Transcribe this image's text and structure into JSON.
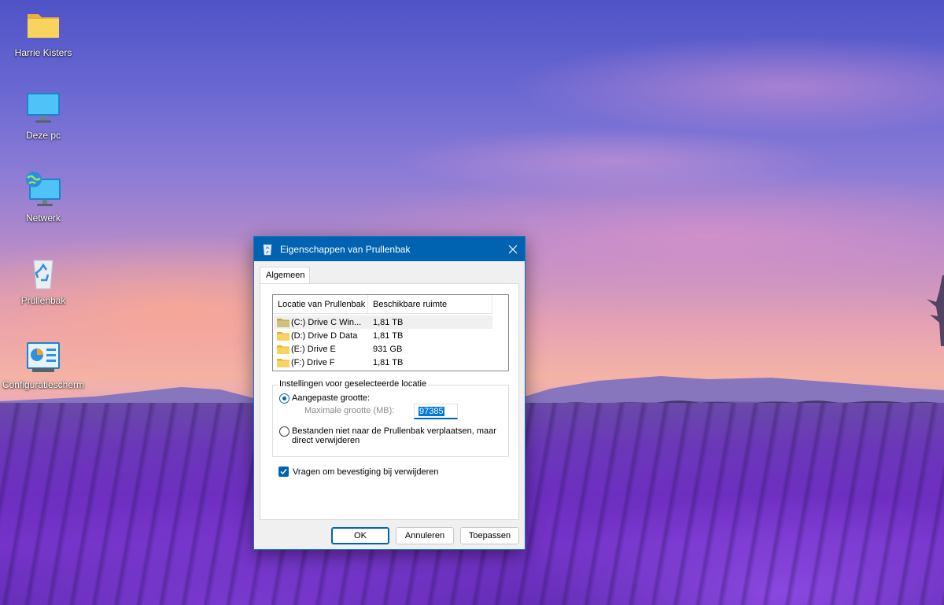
{
  "desktop": {
    "icons": [
      {
        "label": "Harrie Kisters",
        "icon": "folder-icon"
      },
      {
        "label": "Deze pc",
        "icon": "computer-icon"
      },
      {
        "label": "Netwerk",
        "icon": "network-icon"
      },
      {
        "label": "Prullenbak",
        "icon": "recycle-bin-icon"
      },
      {
        "label": "Configuratiescherm",
        "icon": "control-panel-icon"
      }
    ]
  },
  "dialog": {
    "title": "Eigenschappen van Prullenbak",
    "accent": "#0063b1",
    "tabs": [
      "Algemeen"
    ],
    "list": {
      "headers": [
        "Locatie van Prullenbak",
        "Beschikbare ruimte"
      ],
      "rows": [
        {
          "name": "(C:) Drive C Win...",
          "space": "1,81 TB",
          "selected": true
        },
        {
          "name": "(D:) Drive D Data",
          "space": "1,81 TB",
          "selected": false
        },
        {
          "name": "(E:) Drive E",
          "space": "931 GB",
          "selected": false
        },
        {
          "name": "(F:) Drive F",
          "space": "1,81 TB",
          "selected": false
        }
      ]
    },
    "settings": {
      "legend": "Instellingen voor geselecteerde locatie",
      "custom_size_label": "Aangepaste grootte:",
      "custom_size_selected": true,
      "max_size_label": "Maximale grootte (MB):",
      "max_size_value": "97385",
      "delete_directly_label_line1": "Bestanden niet naar de Prullenbak verplaatsen, maar",
      "delete_directly_label_line2": "direct verwijderen",
      "delete_directly_selected": false
    },
    "confirm_checkbox_label": "Vragen om bevestiging bij verwijderen",
    "confirm_checked": true,
    "buttons": {
      "ok": "OK",
      "cancel": "Annuleren",
      "apply": "Toepassen"
    }
  }
}
